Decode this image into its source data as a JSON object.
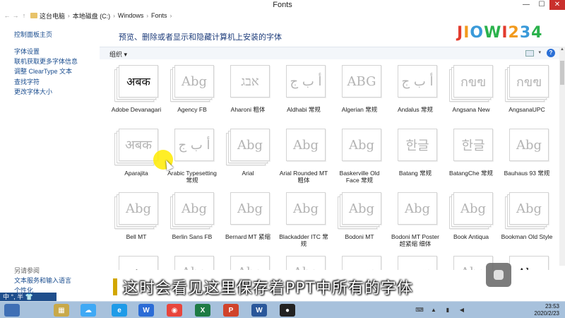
{
  "window": {
    "title": "Fonts",
    "minimize": "—",
    "maximize": "☐",
    "close": "✕"
  },
  "address": {
    "back": "←",
    "forward": "→",
    "up": "↑",
    "crumbs": [
      "这台电脑",
      "本地磁盘 (C:)",
      "Windows",
      "Fonts"
    ],
    "separator": "›"
  },
  "left_pane": {
    "links": [
      "控制面板主页",
      "字体设置",
      "联机获取更多字体信息",
      "调整 ClearType 文本",
      "查找字符",
      "更改字体大小"
    ],
    "see_also_title": "另请参阅",
    "see_also": [
      "文本服务和输入语言",
      "个性化"
    ]
  },
  "header": {
    "heading": "预览、删除或者显示和隐藏计算机上安装的字体",
    "logo": "JIOWI234",
    "logo_colors": [
      "#e23b2e",
      "#f29a1d",
      "#3a9ad9",
      "#2bb24c"
    ]
  },
  "toolbar": {
    "organize": "组织 ▾",
    "view_dropdown": "▾",
    "help": "?"
  },
  "fonts": [
    {
      "sample": "अबक",
      "name": "Adobe Devanagari",
      "stack": true,
      "dark": true
    },
    {
      "sample": "Abg",
      "name": "Agency FB",
      "stack": true
    },
    {
      "sample": "אבג",
      "name": "Aharoni 粗体",
      "stack": false
    },
    {
      "sample": "أ ب ج",
      "name": "Aldhabi 常规",
      "stack": false
    },
    {
      "sample": "ABG",
      "name": "Algerian 常规",
      "stack": false
    },
    {
      "sample": "أ ب ج",
      "name": "Andalus 常规",
      "stack": false
    },
    {
      "sample": "กขฃ",
      "name": "Angsana New",
      "stack": true
    },
    {
      "sample": "กขฃ",
      "name": "AngsanaUPC",
      "stack": true
    },
    {
      "sample": "अबक",
      "name": "Aparajita",
      "stack": true
    },
    {
      "sample": "أ ب ج",
      "name": "Arabic Typesetting 常规",
      "stack": false
    },
    {
      "sample": "Abg",
      "name": "Arial",
      "stack": true
    },
    {
      "sample": "Abg",
      "name": "Arial Rounded MT 粗体",
      "stack": false
    },
    {
      "sample": "Abg",
      "name": "Baskerville Old Face 常规",
      "stack": false
    },
    {
      "sample": "한글",
      "name": "Batang 常规",
      "stack": false
    },
    {
      "sample": "한글",
      "name": "BatangChe 常规",
      "stack": false
    },
    {
      "sample": "Abg",
      "name": "Bauhaus 93 常规",
      "stack": false
    },
    {
      "sample": "Abg",
      "name": "Bell MT",
      "stack": true
    },
    {
      "sample": "Abg",
      "name": "Berlin Sans FB",
      "stack": true
    },
    {
      "sample": "Abg",
      "name": "Bernard MT 紧缩",
      "stack": false
    },
    {
      "sample": "Abg",
      "name": "Blackadder ITC 常规",
      "stack": false
    },
    {
      "sample": "Abg",
      "name": "Bodoni MT",
      "stack": true
    },
    {
      "sample": "Abg",
      "name": "Bodoni MT Poster 超紧缩 细体",
      "stack": false
    },
    {
      "sample": "Abg",
      "name": "Book Antiqua",
      "stack": true
    },
    {
      "sample": "Abg",
      "name": "Bookman Old Style",
      "stack": true
    },
    {
      "sample": "∴·",
      "name": "",
      "stack": false,
      "dark": true
    },
    {
      "sample": "Abg",
      "name": "",
      "stack": false
    },
    {
      "sample": "Abg",
      "name": "",
      "stack": false
    },
    {
      "sample": "Abg",
      "name": "",
      "stack": false
    },
    {
      "sample": "กขฃ",
      "name": "",
      "stack": false
    },
    {
      "sample": "กขฃ",
      "name": "",
      "stack": false
    },
    {
      "sample": "Abg",
      "name": "",
      "stack": false
    },
    {
      "sample": "Abg",
      "name": "",
      "stack": false,
      "dark": true
    }
  ],
  "subtitle": "这时会看见这里保存着PPT中所有的字体",
  "ime": "中  °, 半 👕",
  "taskbar": {
    "apps": [
      {
        "label": "▦",
        "color": "#c8a94a"
      },
      {
        "label": "☁",
        "color": "#3fa9f5"
      },
      {
        "label": "e",
        "color": "#1e9be8"
      },
      {
        "label": "W",
        "color": "#2b6cd6"
      },
      {
        "label": "◉",
        "color": "#e8453c"
      },
      {
        "label": "X",
        "color": "#1e7b45"
      },
      {
        "label": "P",
        "color": "#d0432b"
      },
      {
        "label": "W",
        "color": "#2a579a"
      },
      {
        "label": "●",
        "color": "#222222"
      }
    ],
    "time": "23:53",
    "date": "2020/2/23"
  }
}
